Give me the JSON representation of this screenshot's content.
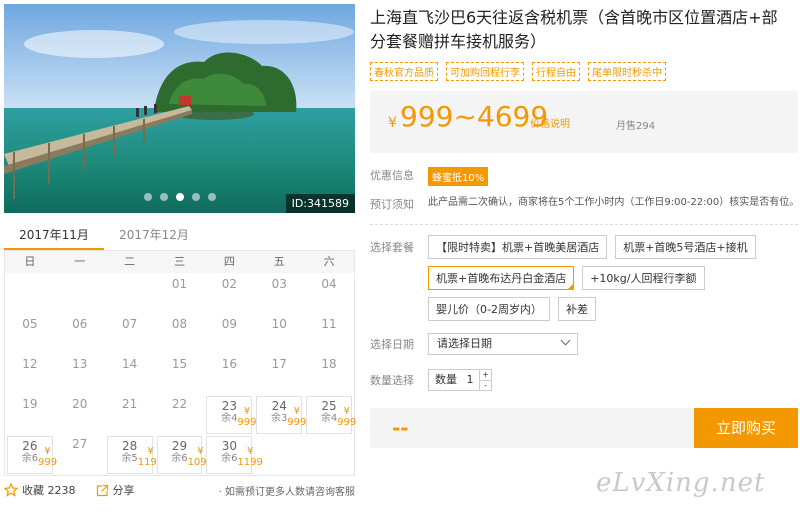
{
  "photo": {
    "id_label": "ID:341589",
    "slides": 5,
    "active_slide": 3
  },
  "calendar": {
    "tabs": [
      {
        "label": "2017年11月",
        "active": true
      },
      {
        "label": "2017年12月",
        "active": false
      }
    ],
    "weekdays": [
      "日",
      "一",
      "二",
      "三",
      "四",
      "五",
      "六"
    ],
    "days": [
      {
        "day": ""
      },
      {
        "day": ""
      },
      {
        "day": ""
      },
      {
        "day": "01"
      },
      {
        "day": "02"
      },
      {
        "day": "03"
      },
      {
        "day": "04"
      },
      {
        "day": "05"
      },
      {
        "day": "06"
      },
      {
        "day": "07"
      },
      {
        "day": "08"
      },
      {
        "day": "09"
      },
      {
        "day": "10"
      },
      {
        "day": "11"
      },
      {
        "day": "12"
      },
      {
        "day": "13"
      },
      {
        "day": "14"
      },
      {
        "day": "15"
      },
      {
        "day": "16"
      },
      {
        "day": "17"
      },
      {
        "day": "18"
      },
      {
        "day": "19"
      },
      {
        "day": "20"
      },
      {
        "day": "21"
      },
      {
        "day": "22"
      },
      {
        "day": "23",
        "price": "¥ 999",
        "left": "余4"
      },
      {
        "day": "24",
        "price": "¥ 999",
        "left": "余3"
      },
      {
        "day": "25",
        "price": "¥ 999",
        "left": "余4"
      },
      {
        "day": "26",
        "price": "¥ 999",
        "left": "余6"
      },
      {
        "day": "27"
      },
      {
        "day": "28",
        "price": "¥ 1199",
        "left": "余5"
      },
      {
        "day": "29",
        "price": "¥ 1099",
        "left": "余6"
      },
      {
        "day": "30",
        "price": "¥ 1199",
        "left": "余6"
      }
    ]
  },
  "actions": {
    "favorite_label": "收藏 2238",
    "share_label": "分享",
    "hint": "· 如需预订更多人数请咨询客服"
  },
  "product": {
    "title": "上海直飞沙巴6天往返含税机票（含首晚市区位置酒店+部分套餐赠拼车接机服务）",
    "tags": [
      "春秋官方品质",
      "可加购回程行李",
      "行程自由",
      "尾单限时秒杀中"
    ],
    "currency": "¥",
    "price": "999~4699",
    "price_note": "价格说明",
    "sold": "月售294",
    "offer_label": "优惠信息",
    "coupon": "蜂蜜抵10%",
    "notice_label": "预订须知",
    "notice": "此产品需二次确认，商家将在5个工作小时内（工作日9:00-22:00）核实是否有位。",
    "package_label": "选择套餐",
    "packages": [
      {
        "label": "【限时特卖】机票+首晚美居酒店",
        "selected": false
      },
      {
        "label": "机票+首晚5号酒店+接机",
        "selected": false
      },
      {
        "label": "机票+首晚布达丹白金酒店",
        "selected": true
      },
      {
        "label": "+10kg/人回程行李额",
        "selected": false
      },
      {
        "label": "婴儿价（0-2周岁内）",
        "selected": false
      },
      {
        "label": "补差",
        "selected": false
      }
    ],
    "date_label": "选择日期",
    "date_placeholder": "请选择日期",
    "qty_label": "数量选择",
    "qty_inner_label": "数量",
    "qty_value": "1",
    "total": "--",
    "buy_label": "立即购买"
  },
  "watermark": "eLvXing.net",
  "colors": {
    "accent": "#f39800"
  }
}
